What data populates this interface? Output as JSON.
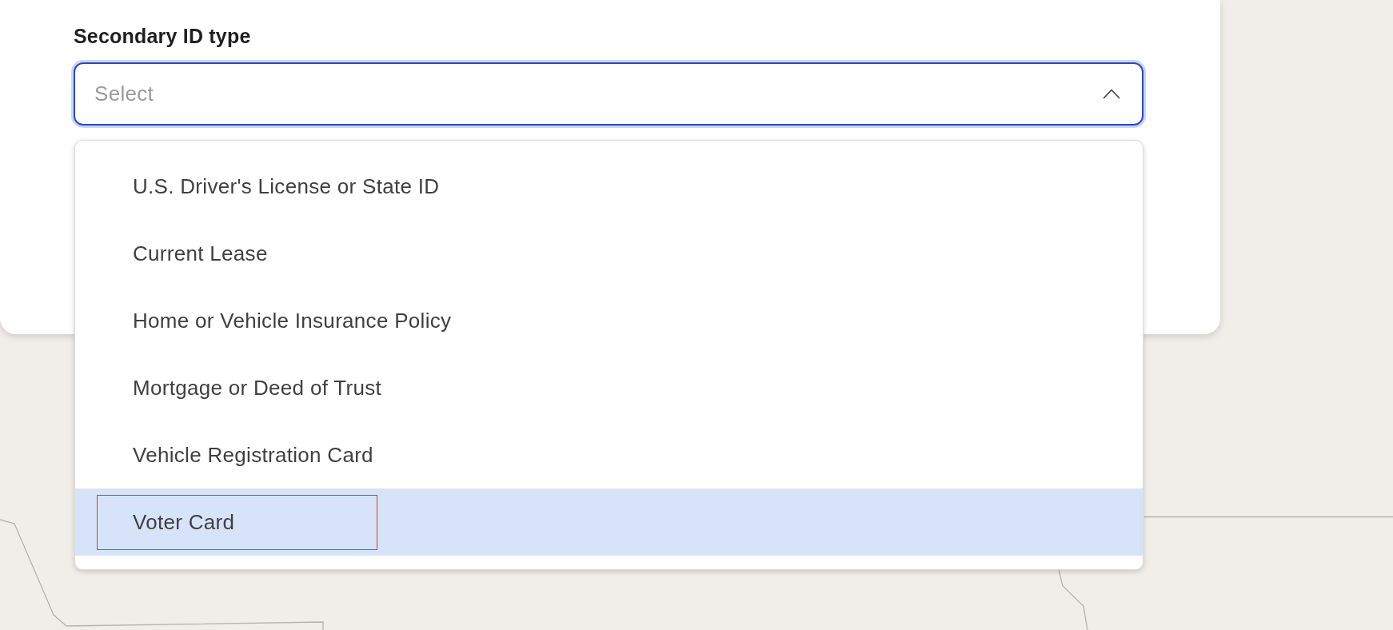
{
  "field": {
    "label": "Secondary ID type",
    "placeholder": "Select",
    "expanded": true
  },
  "options": [
    {
      "label": "U.S. Driver's License or State ID",
      "selected": false,
      "outlined": false
    },
    {
      "label": "Current Lease",
      "selected": false,
      "outlined": false
    },
    {
      "label": "Home or Vehicle Insurance Policy",
      "selected": false,
      "outlined": false
    },
    {
      "label": "Mortgage or Deed of Trust",
      "selected": false,
      "outlined": false
    },
    {
      "label": "Vehicle Registration Card",
      "selected": false,
      "outlined": false
    },
    {
      "label": "Voter Card",
      "selected": true,
      "outlined": true
    }
  ]
}
